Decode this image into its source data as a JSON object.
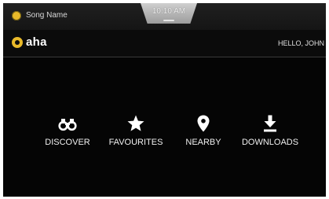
{
  "status_bar": {
    "song_name": "Song Name",
    "clock": "10:10 AM"
  },
  "app_bar": {
    "logo_text": "aha",
    "greeting": "HELLO, JOHN"
  },
  "menu": {
    "items": [
      {
        "label": "DISCOVER",
        "icon": "binoculars-icon"
      },
      {
        "label": "FAVOURITES",
        "icon": "star-icon"
      },
      {
        "label": "NEARBY",
        "icon": "location-pin-icon"
      },
      {
        "label": "DOWNLOADS",
        "icon": "download-icon"
      }
    ]
  },
  "colors": {
    "background": "#050505",
    "accent": "#e8b92a",
    "text": "#f0f0f0"
  }
}
